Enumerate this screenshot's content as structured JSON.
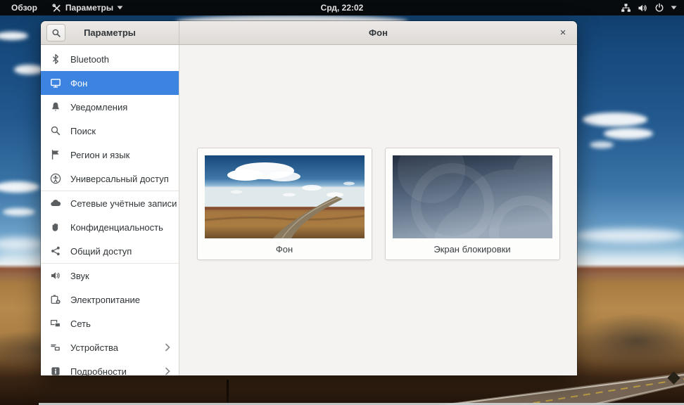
{
  "topbar": {
    "activities_label": "Обзор",
    "app_menu_label": "Параметры",
    "clock": "Срд, 22:02",
    "status_icons": [
      "network-wired-icon",
      "volume-icon",
      "power-icon",
      "caret-down-icon"
    ]
  },
  "window": {
    "sidebar": {
      "title": "Параметры",
      "search_icon": "magnifier",
      "items": [
        {
          "label": "Bluetooth",
          "icon": "bluetooth-icon",
          "selected": false
        },
        {
          "label": "Фон",
          "icon": "display-icon",
          "selected": true
        },
        {
          "label": "Уведомления",
          "icon": "bell-icon",
          "selected": false
        },
        {
          "label": "Поиск",
          "icon": "search-icon",
          "selected": false
        },
        {
          "label": "Регион и язык",
          "icon": "flag-icon",
          "selected": false
        },
        {
          "label": "Универсальный доступ",
          "icon": "accessibility-icon",
          "selected": false
        },
        {
          "label": "Сетевые учётные записи",
          "icon": "cloud-icon",
          "selected": false
        },
        {
          "label": "Конфиденциальность",
          "icon": "hand-icon",
          "selected": false
        },
        {
          "label": "Общий доступ",
          "icon": "share-icon",
          "selected": false
        },
        {
          "label": "Звук",
          "icon": "speaker-icon",
          "selected": false
        },
        {
          "label": "Электропитание",
          "icon": "battery-icon",
          "selected": false
        },
        {
          "label": "Сеть",
          "icon": "network-icon",
          "selected": false
        },
        {
          "label": "Устройства",
          "icon": "devices-icon",
          "selected": false,
          "chevron": true
        },
        {
          "label": "Подробности",
          "icon": "info-icon",
          "selected": false,
          "chevron": true
        }
      ]
    },
    "header": {
      "title": "Фон",
      "close_label": "×"
    },
    "cards": [
      {
        "label": "Фон",
        "thumbnail": "desert-landscape-wallpaper"
      },
      {
        "label": "Экран блокировки",
        "thumbnail": "lock-screen-swirl-wallpaper"
      }
    ]
  },
  "colors": {
    "accent_selected": "#3d84e0",
    "topbar_bg": "#070b0e",
    "header_bg": "#e6e3e0",
    "sidebar_bg": "#ffffff",
    "content_bg": "#f4f3f1"
  }
}
